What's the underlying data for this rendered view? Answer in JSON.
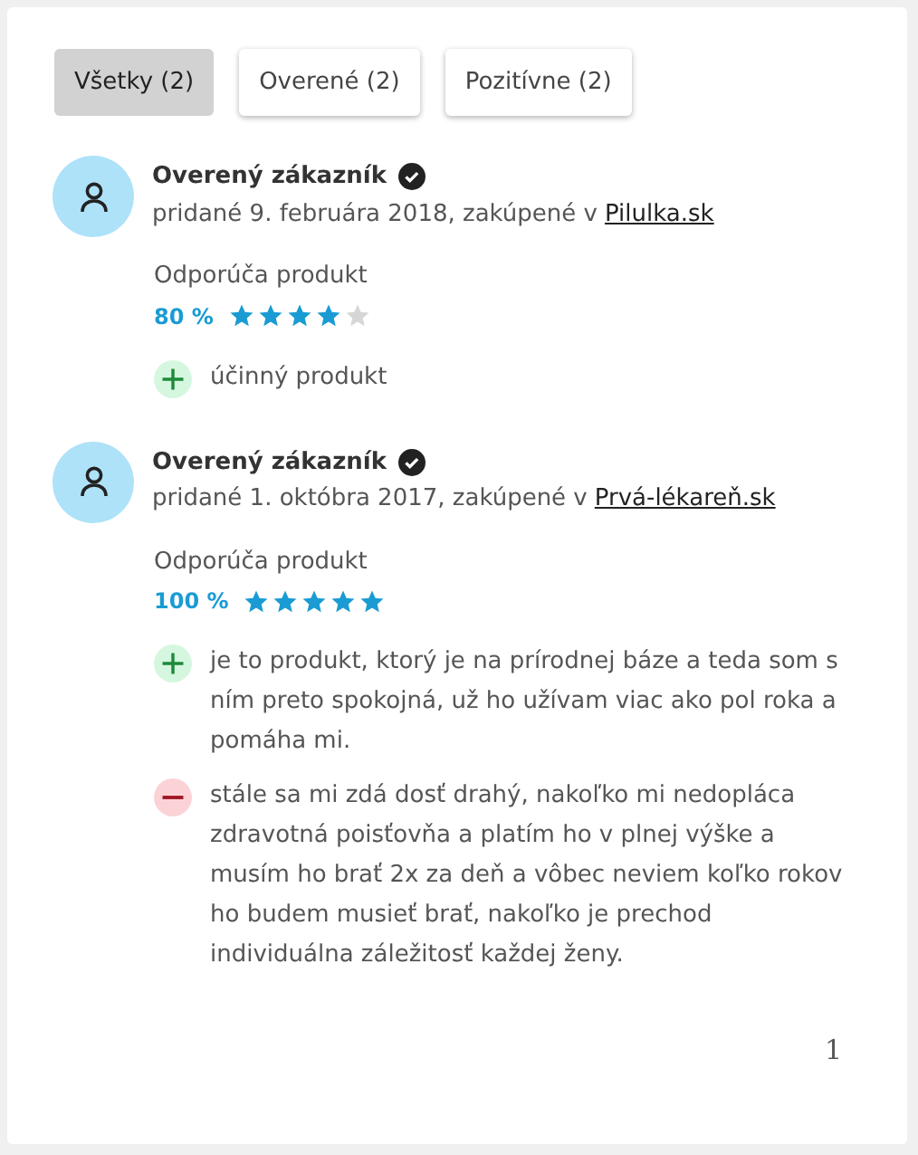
{
  "tabs": [
    {
      "label": "Všetky (2)",
      "selected": true
    },
    {
      "label": "Overené (2)",
      "selected": false
    },
    {
      "label": "Pozitívne (2)",
      "selected": false
    }
  ],
  "reviews": [
    {
      "author": "Overený zákazník",
      "verified": true,
      "added": "pridané 9. februára 2018, zakúpené v",
      "shop": "Pilulka.sk",
      "recommend_label": "Odporúča produkt",
      "percent": "80 %",
      "stars": 4,
      "points": [
        {
          "kind": "pro",
          "text": "účinný produkt"
        }
      ]
    },
    {
      "author": "Overený zákazník",
      "verified": true,
      "added": "pridané 1. októbra 2017, zakúpené v",
      "shop": "Prvá-lékareň.sk",
      "recommend_label": "Odporúča produkt",
      "percent": "100 %",
      "stars": 5,
      "points": [
        {
          "kind": "pro",
          "text": "je to produkt, ktorý je na prírodnej báze a teda som s ním preto spokojná, už ho užívam viac ako pol roka a pomáha mi."
        },
        {
          "kind": "con",
          "text": "stále sa mi zdá dosť drahý, nakoľko mi nedopláca zdravotná poisťovňa a platím ho v plnej výške a musím ho brať 2x za deň a vôbec neviem koľko rokov ho budem musieť brať, nakoľko je prechod individuálna záležitosť každej ženy."
        }
      ]
    }
  ],
  "pagination": {
    "current": "1"
  }
}
